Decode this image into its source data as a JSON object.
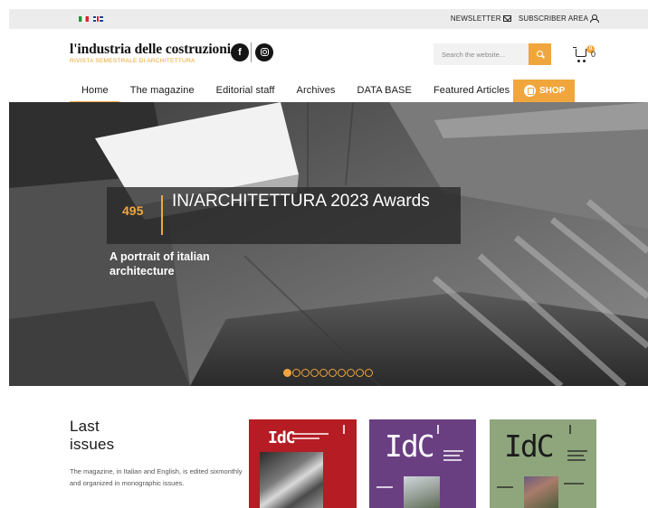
{
  "topbar": {
    "newsletter_label": "NEWSLETTER",
    "subscriber_label": "SUBSCRIBER AREA",
    "flags": [
      "italian-flag-icon",
      "english-flag-icon"
    ]
  },
  "header": {
    "logo_name": "l'industria delle costruzioni",
    "logo_tagline": "RIVISTA SEMESTRALE DI ARCHITETTURA",
    "search_placeholder": "Search the website...",
    "cart_badge": "0",
    "cart_count": "0"
  },
  "nav": {
    "items": [
      {
        "label": "Home"
      },
      {
        "label": "The magazine"
      },
      {
        "label": "Editorial staff"
      },
      {
        "label": "Archives"
      },
      {
        "label": "DATA BASE"
      },
      {
        "label": "Featured Articles"
      }
    ],
    "shop_label": "SHOP"
  },
  "hero": {
    "number": "495",
    "title": "IN/ARCHITETTURA 2023 Awards",
    "subtitle": "A portrait of italian architecture",
    "slide_count": 10,
    "active_slide": 1
  },
  "last_issues": {
    "title": "Last issues",
    "description": "The magazine, in Italian and English, is edited sixmonthly and organized in monographic issues.",
    "covers": [
      {
        "brand": "IdC",
        "color": "#b51c23"
      },
      {
        "brand": "IdC",
        "color": "#6a3f82"
      },
      {
        "brand": "IdC",
        "color": "#8fa67d"
      }
    ]
  },
  "colors": {
    "accent": "#f1a63d",
    "topbar_bg": "#ececec"
  }
}
